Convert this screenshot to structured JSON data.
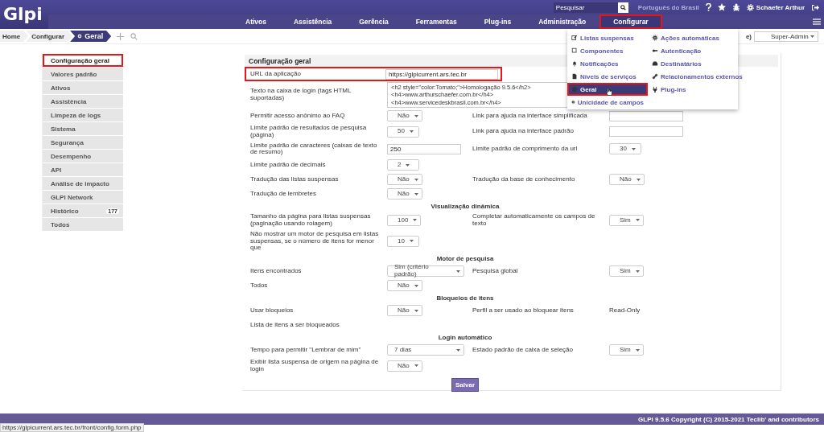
{
  "header": {
    "logo": "Glpi",
    "search": {
      "placeholder": "Pesquisar"
    },
    "language": "Português do Brasil",
    "user": "Schaefer Arthur"
  },
  "nav": [
    {
      "label": "Ativos",
      "selected": false,
      "annotated": false
    },
    {
      "label": "Assistência",
      "selected": false,
      "annotated": false
    },
    {
      "label": "Gerência",
      "selected": false,
      "annotated": false
    },
    {
      "label": "Ferramentas",
      "selected": false,
      "annotated": false
    },
    {
      "label": "Plug-ins",
      "selected": false,
      "annotated": false
    },
    {
      "label": "Administração",
      "selected": false,
      "annotated": false
    },
    {
      "label": "Configurar",
      "selected": true,
      "annotated": true
    }
  ],
  "breadcrumb": [
    {
      "label": "Home",
      "selected": false
    },
    {
      "label": "Configurar",
      "selected": false
    },
    {
      "label": "Geral",
      "selected": true
    }
  ],
  "entity_label": "e)",
  "profile": "Super-Admin",
  "menu": {
    "columns": [
      [
        {
          "label": "Listas suspensas",
          "kind": "edit",
          "selected": false,
          "annotated": false
        },
        {
          "label": "Componentes",
          "kind": "square",
          "selected": false,
          "annotated": false
        },
        {
          "label": "Notificações",
          "kind": "bell",
          "selected": false,
          "annotated": false
        },
        {
          "label": "Níveis de serviços",
          "kind": "doc",
          "selected": false,
          "annotated": false
        },
        {
          "label": "Geral",
          "kind": "gear",
          "selected": true,
          "annotated": true
        },
        {
          "label": "Unicidade de campos",
          "kind": "gear",
          "selected": false,
          "annotated": false
        }
      ],
      [
        {
          "label": "Ações automáticas",
          "kind": "gear",
          "selected": false,
          "annotated": false
        },
        {
          "label": "Autenticação",
          "kind": "key",
          "selected": false,
          "annotated": false
        },
        {
          "label": "Destinatários",
          "kind": "inbox",
          "selected": false,
          "annotated": false
        },
        {
          "label": "Relacionamentos externos",
          "kind": "link",
          "selected": false,
          "annotated": false
        },
        {
          "label": "Plug-ins",
          "kind": "plug",
          "selected": false,
          "annotated": false
        }
      ]
    ]
  },
  "sidebar": {
    "items": [
      {
        "label": "Configuração geral",
        "selected": true,
        "annotated": true
      },
      {
        "label": "Valores padrão",
        "selected": false,
        "annotated": false
      },
      {
        "label": "Ativos",
        "selected": false,
        "annotated": false
      },
      {
        "label": "Assistência",
        "selected": false,
        "annotated": false
      },
      {
        "label": "Limpeza de logs",
        "selected": false,
        "annotated": false
      },
      {
        "label": "Sistema",
        "selected": false,
        "annotated": false
      },
      {
        "label": "Segurança",
        "selected": false,
        "annotated": false
      },
      {
        "label": "Desempenho",
        "selected": false,
        "annotated": false
      },
      {
        "label": "API",
        "selected": false,
        "annotated": false
      },
      {
        "label": "Análise de impacto",
        "selected": false,
        "annotated": false
      },
      {
        "label": "GLPI Network",
        "selected": false,
        "annotated": false
      },
      {
        "label": "Histórico",
        "count": "177",
        "selected": false,
        "annotated": false
      },
      {
        "label": "Todos",
        "selected": false,
        "annotated": false
      }
    ]
  },
  "form": {
    "title": "Configuração geral",
    "rows": [
      {
        "kind": "row",
        "annotated": true,
        "label": "URL da aplicação",
        "value": {
          "kind": "wide-input",
          "text": "https://glpicurrent.ars.tec.br"
        }
      },
      {
        "kind": "row",
        "annotated": false,
        "label": "Texto na caixa de login (tags HTML suportadas)",
        "value": {
          "kind": "textarea",
          "lines": [
            "<h2 style=\"color:Tomato;\">Homologação 9.5.6</h2>",
            "<h4>www.arthurschaefer.com.br</h4>",
            "<h4>www.servicedeskbrasil.com.br</h4>"
          ]
        }
      },
      {
        "kind": "row",
        "annotated": false,
        "label": "Permitir acesso anônimo ao FAQ",
        "value": {
          "kind": "select",
          "text": "Não"
        },
        "label2": "Link para ajuda na interface simplificada",
        "value2": {
          "kind": "input"
        }
      },
      {
        "kind": "row",
        "annotated": false,
        "label": "Limite padrão de resultados de pesquisa (página)",
        "value": {
          "kind": "select",
          "text": "50"
        },
        "label2": "Link para ajuda na interface padrão",
        "value2": {
          "kind": "input"
        }
      },
      {
        "kind": "row",
        "annotated": false,
        "label": "Limite padrão de caracteres (caixas de texto de resumo)",
        "value": {
          "kind": "input",
          "text": "250"
        },
        "label2": "Limite padrão de comprimento da url",
        "value2": {
          "kind": "select",
          "text": "30"
        }
      },
      {
        "kind": "row",
        "annotated": false,
        "label": "Limite padrão de decimais",
        "value": {
          "kind": "select",
          "text": "2"
        }
      },
      {
        "kind": "row",
        "annotated": false,
        "label": "Tradução das listas suspensas",
        "value": {
          "kind": "select",
          "text": "Não"
        },
        "label2": "Tradução da base de conhecimento",
        "value2": {
          "kind": "select",
          "text": "Não"
        }
      },
      {
        "kind": "row",
        "annotated": false,
        "label": "Tradução de lembretes",
        "value": {
          "kind": "select",
          "text": "Não"
        }
      },
      {
        "kind": "section",
        "title": "Visualização dinâmica"
      },
      {
        "kind": "row",
        "annotated": false,
        "label": "Tamanho da página para listas suspensas (paginação usando rolagem)",
        "value": {
          "kind": "select",
          "text": "100"
        },
        "label2": "Completar automaticamente os campos de texto",
        "value2": {
          "kind": "select",
          "text": "Sim"
        }
      },
      {
        "kind": "row",
        "annotated": false,
        "label": "Não mostrar um motor de pesquisa em listas suspensas, se o número de itens for menor que",
        "value": {
          "kind": "select",
          "text": "10"
        }
      },
      {
        "kind": "section",
        "title": "Motor de pesquisa"
      },
      {
        "kind": "row",
        "annotated": false,
        "label": "Itens encontrados",
        "value": {
          "kind": "wide-select",
          "text": "Sim (critério padrão)"
        },
        "label2": "Pesquisa global",
        "value2": {
          "kind": "select",
          "text": "Sim"
        }
      },
      {
        "kind": "row",
        "annotated": false,
        "label": "Todos",
        "value": {
          "kind": "select",
          "text": "Não"
        }
      },
      {
        "kind": "section",
        "title": "Bloqueios de itens"
      },
      {
        "kind": "row",
        "annotated": false,
        "label": "Usar bloqueios",
        "value": {
          "kind": "select",
          "text": "Não"
        },
        "label2": "Perfil a ser usado ao bloquear itens",
        "value2": {
          "kind": "plain",
          "text": "Read-Only"
        }
      },
      {
        "kind": "row",
        "annotated": false,
        "label": "Lista de itens a ser bloqueados"
      },
      {
        "kind": "section",
        "title": "Login automático"
      },
      {
        "kind": "row",
        "annotated": false,
        "label": "Tempo para permitir \"Lembrar de mim\"",
        "value": {
          "kind": "wide-select",
          "text": "7 dias"
        },
        "label2": "Estado padrão de caixa de seleção",
        "value2": {
          "kind": "select",
          "text": "Sim"
        }
      },
      {
        "kind": "row",
        "annotated": false,
        "label": "Exibir lista suspensa de origem na página de login",
        "value": {
          "kind": "select",
          "text": "Não"
        }
      }
    ],
    "save_button": "Salvar"
  },
  "footer": "GLPI 9.5.6 Copyright (C) 2015-2021 Teclib' and contributors",
  "status_url": "https://glpicurrent.ars.tec.br/front/config.form.php"
}
